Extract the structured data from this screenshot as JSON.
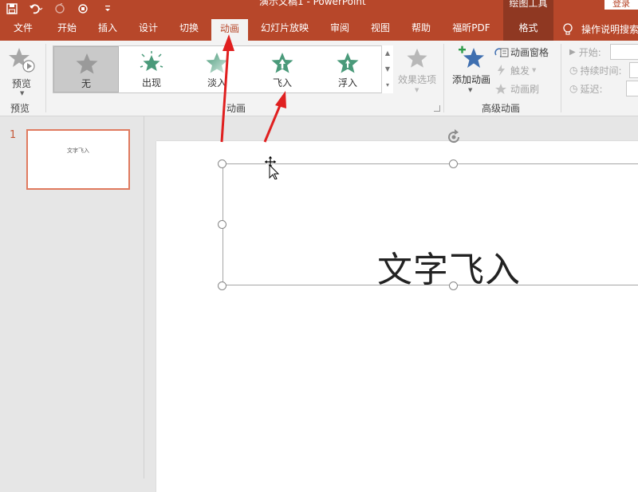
{
  "window": {
    "title": "演示文稿1 - PowerPoint",
    "context_group": "绘图工具",
    "login_label": "登录"
  },
  "tabs": [
    {
      "label": "文件"
    },
    {
      "label": "开始"
    },
    {
      "label": "插入"
    },
    {
      "label": "设计"
    },
    {
      "label": "切换"
    },
    {
      "label": "动画"
    },
    {
      "label": "幻灯片放映"
    },
    {
      "label": "审阅"
    },
    {
      "label": "视图"
    },
    {
      "label": "帮助"
    },
    {
      "label": "福昕PDF"
    },
    {
      "label": "格式"
    }
  ],
  "active_tab": "动画",
  "tell_me": "操作说明搜索",
  "ribbon": {
    "preview": {
      "button_label": "预览",
      "group_label": "预览"
    },
    "animation_group": {
      "label": "动画",
      "items": [
        {
          "label": "无"
        },
        {
          "label": "出现"
        },
        {
          "label": "淡入"
        },
        {
          "label": "飞入"
        },
        {
          "label": "浮入"
        }
      ],
      "selected": "无",
      "effect_options": "效果选项"
    },
    "advanced": {
      "label": "高级动画",
      "add_animation": "添加动画",
      "animation_pane": "动画窗格",
      "trigger": "触发",
      "painter": "动画刷"
    },
    "timing": {
      "start": "开始:",
      "duration": "持续时间:",
      "delay": "延迟:"
    }
  },
  "colors": {
    "accent": "#b7472a",
    "star_green": "#4a9a7a",
    "star_blue": "#3f6fb0"
  },
  "slides_panel": {
    "slide_number": "1",
    "thumb_text": "文字飞入"
  },
  "slide": {
    "text": "文字飞入"
  }
}
